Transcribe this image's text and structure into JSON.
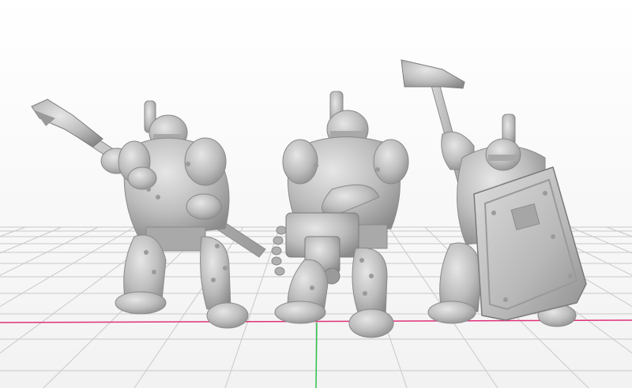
{
  "viewport": {
    "background_top": "#ffffff",
    "background_bottom": "#f2f2f2",
    "grid_color": "#c9c9c9",
    "x_axis_color": "#e0307a",
    "y_axis_color": "#2fc24a",
    "model_color": "#bdbdbd",
    "model_shadow": "#8e8e8e",
    "model_highlight": "#e4e4e4"
  },
  "models": [
    {
      "name": "miniature-with-halberd",
      "weapon": "halberd"
    },
    {
      "name": "miniature-with-heavy-gun",
      "weapon": "heavy-gun"
    },
    {
      "name": "miniature-with-hammer-and-shield",
      "weapon": "hammer-and-shield"
    }
  ]
}
